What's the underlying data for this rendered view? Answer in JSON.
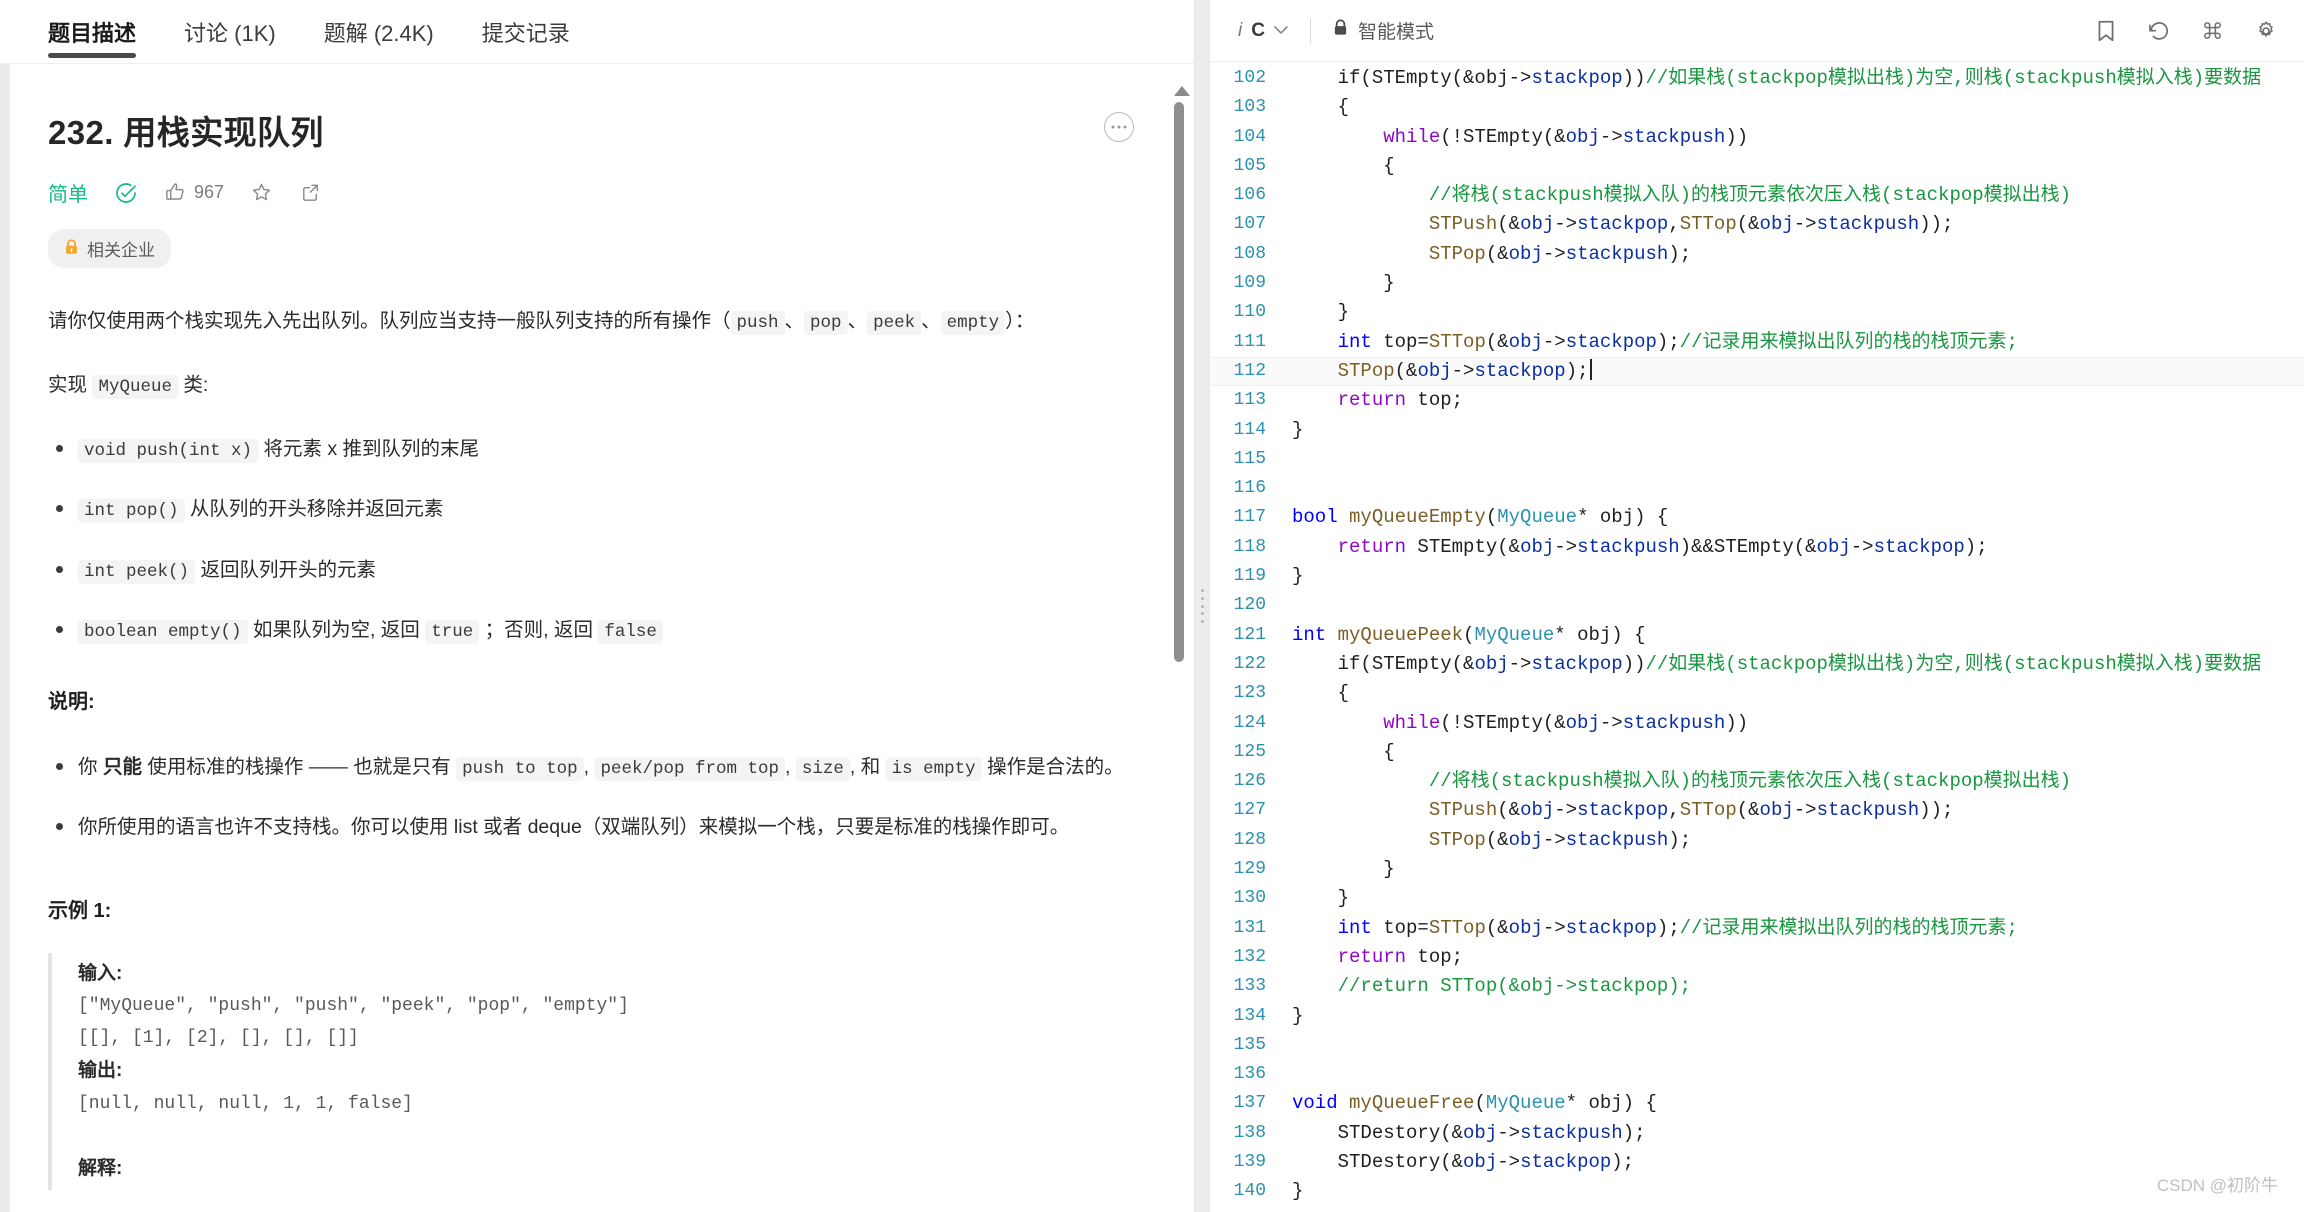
{
  "left": {
    "tabs": [
      {
        "label": "题目描述",
        "active": true
      },
      {
        "label": "讨论 (1K)",
        "active": false
      },
      {
        "label": "题解 (2.4K)",
        "active": false
      },
      {
        "label": "提交记录",
        "active": false
      }
    ],
    "title": "232. 用栈实现队列",
    "difficulty": "简单",
    "like_count": "967",
    "company_tag": "相关企业",
    "intro_line_1": "请你仅使用两个栈实现先入先出队列。队列应当支持一般队列支持的所有操作（",
    "intro_codes": [
      "push",
      "pop",
      "peek",
      "empty"
    ],
    "intro_sep": "、",
    "intro_tail": "）：",
    "impl_prefix": "实现",
    "impl_class": "MyQueue",
    "impl_suffix": "类:",
    "methods": [
      {
        "code": "void push(int x)",
        "text": "将元素 x 推到队列的末尾"
      },
      {
        "code": "int pop()",
        "text": "从队列的开头移除并返回元素"
      },
      {
        "code": "int peek()",
        "text": "返回队列开头的元素"
      }
    ],
    "method_empty": {
      "code": "boolean empty()",
      "t1": "如果队列为空, 返回",
      "c1": "true",
      "t2": "；否则, 返回",
      "c2": "false"
    },
    "notes_heading": "说明:",
    "note1": {
      "a": "你",
      "bold": "只能",
      "b": "使用标准的栈操作 —— 也就是只有",
      "c1": "push to top",
      "sep1": ",",
      "c2": "peek/pop from top",
      "sep2": ",",
      "c3": "size",
      "sep3": ", 和",
      "c4": "is empty",
      "d": "操作是合法的。"
    },
    "note2": "你所使用的语言也许不支持栈。你可以使用 list 或者 deque（双端队列）来模拟一个栈，只要是标准的栈操作即可。",
    "example_heading": "示例 1:",
    "example_body": "输入:\n[\"MyQueue\", \"push\", \"push\", \"peek\", \"pop\", \"empty\"]\n[[], [1], [2], [], [], []]\n输出:\n[null, null, null, 1, 1, false]\n解释:",
    "example_labels": {
      "input": "输入:",
      "output": "输出:",
      "explain": "解释:"
    },
    "example_lines": [
      "[\"MyQueue\", \"push\", \"push\", \"peek\", \"pop\", \"empty\"]",
      "[[], [1], [2], [], [], []]"
    ],
    "example_output_line": "[null, null, null, 1, 1, false]",
    "more_icon": "···"
  },
  "editor": {
    "language": "C",
    "lang_info_icon": "i",
    "smart_mode": "智能模式",
    "lock_icon": "🔒",
    "toolbar_icons": [
      "bookmark-icon",
      "history-icon",
      "command-icon",
      "settings-icon"
    ],
    "first_line_number": 102,
    "highlighted_line": 112,
    "lines": [
      {
        "n": 102,
        "tokens": [
          {
            "t": "    if(STEmpty(&obj->",
            "c": "pl"
          },
          {
            "t": "stackpop",
            "c": "id"
          },
          {
            "t": "))",
            "c": "pl"
          },
          {
            "t": "//如果栈(stackpop模拟出栈)为空,则栈(stackpush模拟入栈)要数据",
            "c": "cm"
          }
        ]
      },
      {
        "n": 103,
        "tokens": [
          {
            "t": "    {",
            "c": "pl"
          }
        ]
      },
      {
        "n": 104,
        "tokens": [
          {
            "t": "        ",
            "c": "pl"
          },
          {
            "t": "while",
            "c": "kw2"
          },
          {
            "t": "(!STEmpty(&",
            "c": "pl"
          },
          {
            "t": "obj",
            "c": "id"
          },
          {
            "t": "->",
            "c": "pl"
          },
          {
            "t": "stackpush",
            "c": "id"
          },
          {
            "t": "))",
            "c": "pl"
          }
        ]
      },
      {
        "n": 105,
        "tokens": [
          {
            "t": "        {",
            "c": "pl"
          }
        ]
      },
      {
        "n": 106,
        "tokens": [
          {
            "t": "            //将栈(stackpush模拟入队)的栈顶元素依次压入栈(stackpop模拟出栈)",
            "c": "cm"
          }
        ]
      },
      {
        "n": 107,
        "tokens": [
          {
            "t": "            ",
            "c": "pl"
          },
          {
            "t": "STPush",
            "c": "fn"
          },
          {
            "t": "(&",
            "c": "pl"
          },
          {
            "t": "obj",
            "c": "id"
          },
          {
            "t": "->",
            "c": "pl"
          },
          {
            "t": "stackpop",
            "c": "id"
          },
          {
            "t": ",",
            "c": "pl"
          },
          {
            "t": "STTop",
            "c": "fn"
          },
          {
            "t": "(&",
            "c": "pl"
          },
          {
            "t": "obj",
            "c": "id"
          },
          {
            "t": "->",
            "c": "pl"
          },
          {
            "t": "stackpush",
            "c": "id"
          },
          {
            "t": "));",
            "c": "pl"
          }
        ]
      },
      {
        "n": 108,
        "tokens": [
          {
            "t": "            ",
            "c": "pl"
          },
          {
            "t": "STPop",
            "c": "fn"
          },
          {
            "t": "(&",
            "c": "pl"
          },
          {
            "t": "obj",
            "c": "id"
          },
          {
            "t": "->",
            "c": "pl"
          },
          {
            "t": "stackpush",
            "c": "id"
          },
          {
            "t": ");",
            "c": "pl"
          }
        ]
      },
      {
        "n": 109,
        "tokens": [
          {
            "t": "        }",
            "c": "pl"
          }
        ]
      },
      {
        "n": 110,
        "tokens": [
          {
            "t": "    }",
            "c": "pl"
          }
        ]
      },
      {
        "n": 111,
        "tokens": [
          {
            "t": "    ",
            "c": "pl"
          },
          {
            "t": "int",
            "c": "kw"
          },
          {
            "t": " top=",
            "c": "pl"
          },
          {
            "t": "STTop",
            "c": "fn"
          },
          {
            "t": "(&",
            "c": "pl"
          },
          {
            "t": "obj",
            "c": "id"
          },
          {
            "t": "->",
            "c": "pl"
          },
          {
            "t": "stackpop",
            "c": "id"
          },
          {
            "t": ");",
            "c": "pl"
          },
          {
            "t": "//记录用来模拟出队列的栈的栈顶元素;",
            "c": "cm"
          }
        ]
      },
      {
        "n": 112,
        "tokens": [
          {
            "t": "    ",
            "c": "pl"
          },
          {
            "t": "STPop",
            "c": "fn"
          },
          {
            "t": "(&",
            "c": "pl"
          },
          {
            "t": "obj",
            "c": "id"
          },
          {
            "t": "->",
            "c": "pl"
          },
          {
            "t": "stackpop",
            "c": "id"
          },
          {
            "t": ");",
            "c": "pl"
          }
        ],
        "caret": true
      },
      {
        "n": 113,
        "tokens": [
          {
            "t": "    ",
            "c": "pl"
          },
          {
            "t": "return",
            "c": "kw2"
          },
          {
            "t": " top;",
            "c": "pl"
          }
        ]
      },
      {
        "n": 114,
        "tokens": [
          {
            "t": "}",
            "c": "pl"
          }
        ]
      },
      {
        "n": 115,
        "tokens": []
      },
      {
        "n": 116,
        "tokens": []
      },
      {
        "n": 117,
        "tokens": [
          {
            "t": "bool",
            "c": "kw"
          },
          {
            "t": " ",
            "c": "pl"
          },
          {
            "t": "myQueueEmpty",
            "c": "fn"
          },
          {
            "t": "(",
            "c": "pl"
          },
          {
            "t": "MyQueue",
            "c": "typ"
          },
          {
            "t": "* obj) {",
            "c": "pl"
          }
        ]
      },
      {
        "n": 118,
        "tokens": [
          {
            "t": "    ",
            "c": "pl"
          },
          {
            "t": "return",
            "c": "kw2"
          },
          {
            "t": " STEmpty(&",
            "c": "pl"
          },
          {
            "t": "obj",
            "c": "id"
          },
          {
            "t": "->",
            "c": "pl"
          },
          {
            "t": "stackpush",
            "c": "id"
          },
          {
            "t": ")&&STEmpty(&",
            "c": "pl"
          },
          {
            "t": "obj",
            "c": "id"
          },
          {
            "t": "->",
            "c": "pl"
          },
          {
            "t": "stackpop",
            "c": "id"
          },
          {
            "t": ");",
            "c": "pl"
          }
        ]
      },
      {
        "n": 119,
        "tokens": [
          {
            "t": "}",
            "c": "pl"
          }
        ]
      },
      {
        "n": 120,
        "tokens": []
      },
      {
        "n": 121,
        "tokens": [
          {
            "t": "int",
            "c": "kw"
          },
          {
            "t": " ",
            "c": "pl"
          },
          {
            "t": "myQueuePeek",
            "c": "fn"
          },
          {
            "t": "(",
            "c": "pl"
          },
          {
            "t": "MyQueue",
            "c": "typ"
          },
          {
            "t": "* obj) {",
            "c": "pl"
          }
        ]
      },
      {
        "n": 122,
        "tokens": [
          {
            "t": "    if(STEmpty(&",
            "c": "pl"
          },
          {
            "t": "obj",
            "c": "id"
          },
          {
            "t": "->",
            "c": "pl"
          },
          {
            "t": "stackpop",
            "c": "id"
          },
          {
            "t": "))",
            "c": "pl"
          },
          {
            "t": "//如果栈(stackpop模拟出栈)为空,则栈(stackpush模拟入栈)要数据",
            "c": "cm"
          }
        ]
      },
      {
        "n": 123,
        "tokens": [
          {
            "t": "    {",
            "c": "pl"
          }
        ]
      },
      {
        "n": 124,
        "tokens": [
          {
            "t": "        ",
            "c": "pl"
          },
          {
            "t": "while",
            "c": "kw2"
          },
          {
            "t": "(!STEmpty(&",
            "c": "pl"
          },
          {
            "t": "obj",
            "c": "id"
          },
          {
            "t": "->",
            "c": "pl"
          },
          {
            "t": "stackpush",
            "c": "id"
          },
          {
            "t": "))",
            "c": "pl"
          }
        ]
      },
      {
        "n": 125,
        "tokens": [
          {
            "t": "        {",
            "c": "pl"
          }
        ]
      },
      {
        "n": 126,
        "tokens": [
          {
            "t": "            //将栈(stackpush模拟入队)的栈顶元素依次压入栈(stackpop模拟出栈)",
            "c": "cm"
          }
        ]
      },
      {
        "n": 127,
        "tokens": [
          {
            "t": "            ",
            "c": "pl"
          },
          {
            "t": "STPush",
            "c": "fn"
          },
          {
            "t": "(&",
            "c": "pl"
          },
          {
            "t": "obj",
            "c": "id"
          },
          {
            "t": "->",
            "c": "pl"
          },
          {
            "t": "stackpop",
            "c": "id"
          },
          {
            "t": ",",
            "c": "pl"
          },
          {
            "t": "STTop",
            "c": "fn"
          },
          {
            "t": "(&",
            "c": "pl"
          },
          {
            "t": "obj",
            "c": "id"
          },
          {
            "t": "->",
            "c": "pl"
          },
          {
            "t": "stackpush",
            "c": "id"
          },
          {
            "t": "));",
            "c": "pl"
          }
        ]
      },
      {
        "n": 128,
        "tokens": [
          {
            "t": "            ",
            "c": "pl"
          },
          {
            "t": "STPop",
            "c": "fn"
          },
          {
            "t": "(&",
            "c": "pl"
          },
          {
            "t": "obj",
            "c": "id"
          },
          {
            "t": "->",
            "c": "pl"
          },
          {
            "t": "stackpush",
            "c": "id"
          },
          {
            "t": ");",
            "c": "pl"
          }
        ]
      },
      {
        "n": 129,
        "tokens": [
          {
            "t": "        }",
            "c": "pl"
          }
        ]
      },
      {
        "n": 130,
        "tokens": [
          {
            "t": "    }",
            "c": "pl"
          }
        ]
      },
      {
        "n": 131,
        "tokens": [
          {
            "t": "    ",
            "c": "pl"
          },
          {
            "t": "int",
            "c": "kw"
          },
          {
            "t": " top=",
            "c": "pl"
          },
          {
            "t": "STTop",
            "c": "fn"
          },
          {
            "t": "(&",
            "c": "pl"
          },
          {
            "t": "obj",
            "c": "id"
          },
          {
            "t": "->",
            "c": "pl"
          },
          {
            "t": "stackpop",
            "c": "id"
          },
          {
            "t": ");",
            "c": "pl"
          },
          {
            "t": "//记录用来模拟出队列的栈的栈顶元素;",
            "c": "cm"
          }
        ]
      },
      {
        "n": 132,
        "tokens": [
          {
            "t": "    ",
            "c": "pl"
          },
          {
            "t": "return",
            "c": "kw2"
          },
          {
            "t": " top;",
            "c": "pl"
          }
        ]
      },
      {
        "n": 133,
        "tokens": [
          {
            "t": "    //return STTop(&obj->stackpop);",
            "c": "cm"
          }
        ]
      },
      {
        "n": 134,
        "tokens": [
          {
            "t": "}",
            "c": "pl"
          }
        ]
      },
      {
        "n": 135,
        "tokens": []
      },
      {
        "n": 136,
        "tokens": []
      },
      {
        "n": 137,
        "tokens": [
          {
            "t": "void",
            "c": "kw"
          },
          {
            "t": " ",
            "c": "pl"
          },
          {
            "t": "myQueueFree",
            "c": "fn"
          },
          {
            "t": "(",
            "c": "pl"
          },
          {
            "t": "MyQueue",
            "c": "typ"
          },
          {
            "t": "* obj) {",
            "c": "pl"
          }
        ]
      },
      {
        "n": 138,
        "tokens": [
          {
            "t": "    STDestory(&",
            "c": "pl"
          },
          {
            "t": "obj",
            "c": "id"
          },
          {
            "t": "->",
            "c": "pl"
          },
          {
            "t": "stackpush",
            "c": "id"
          },
          {
            "t": ");",
            "c": "pl"
          }
        ]
      },
      {
        "n": 139,
        "tokens": [
          {
            "t": "    STDestory(&",
            "c": "pl"
          },
          {
            "t": "obj",
            "c": "id"
          },
          {
            "t": "->",
            "c": "pl"
          },
          {
            "t": "stackpop",
            "c": "id"
          },
          {
            "t": ");",
            "c": "pl"
          }
        ]
      },
      {
        "n": 140,
        "tokens": [
          {
            "t": "}",
            "c": "pl"
          }
        ]
      }
    ]
  },
  "watermark": "CSDN @初阶牛",
  "colors": {
    "difficulty": "#14b88a",
    "lock": "#f5a524",
    "line_number": "#2b91af",
    "comment": "#1a9641",
    "keyword": "#0000ff",
    "keyword2": "#8f08c4",
    "function": "#795e26",
    "identifier": "#0b2ea0"
  }
}
